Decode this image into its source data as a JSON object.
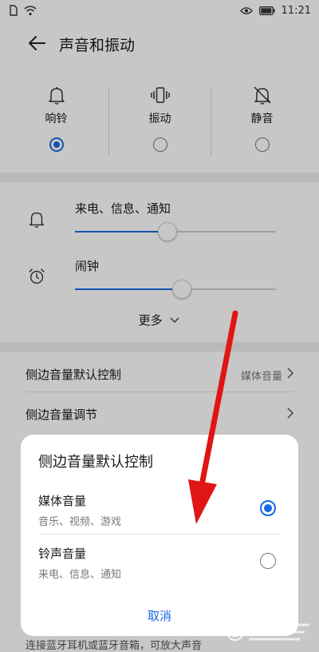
{
  "statusbar": {
    "time": "11:21"
  },
  "header": {
    "title": "声音和振动"
  },
  "modes": [
    {
      "label": "响铃",
      "icon": "bell-icon",
      "selected": true
    },
    {
      "label": "振动",
      "icon": "vibrate-icon",
      "selected": false
    },
    {
      "label": "静音",
      "icon": "bell-off-icon",
      "selected": false
    }
  ],
  "volumes": [
    {
      "label": "来电、信息、通知",
      "icon": "bell-icon",
      "level": 0.46
    },
    {
      "label": "闹钟",
      "icon": "alarm-clock-icon",
      "level": 0.53
    }
  ],
  "more_label": "更多",
  "settings": [
    {
      "label": "侧边音量默认控制",
      "value": "媒体音量"
    },
    {
      "label": "侧边音量调节",
      "value": ""
    }
  ],
  "footer_hint": "连接蓝牙耳机或蓝牙音箱，可放大声音",
  "dialog": {
    "title": "侧边音量默认控制",
    "options": [
      {
        "name": "媒体音量",
        "sub": "音乐、视频、游戏",
        "selected": true
      },
      {
        "name": "铃声音量",
        "sub": "来电、信息、通知",
        "selected": false
      }
    ],
    "cancel": "取消"
  },
  "colors": {
    "accent": "#1769e0",
    "arrow": "#e01515",
    "background": "#ffffff"
  }
}
